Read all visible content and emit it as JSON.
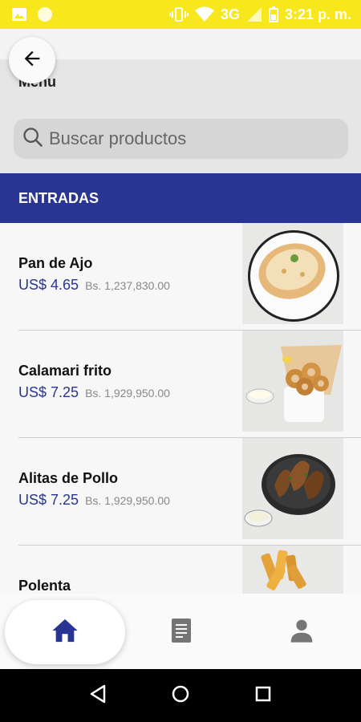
{
  "status_bar": {
    "network": "3G",
    "time": "3:21 p. m.",
    "background": "#f8e71c"
  },
  "header": {
    "title": "Menu"
  },
  "search": {
    "placeholder": "Buscar productos",
    "value": ""
  },
  "section": {
    "title": "ENTRADAS",
    "color": "#283593"
  },
  "products": [
    {
      "name": "Pan de Ajo",
      "price_usd": "US$ 4.65",
      "price_bs": "Bs. 1,237,830.00",
      "image_icon": "garlic-bread-image"
    },
    {
      "name": "Calamari frito",
      "price_usd": "US$ 7.25",
      "price_bs": "Bs. 1,929,950.00",
      "image_icon": "fried-calamari-image"
    },
    {
      "name": "Alitas de Pollo",
      "price_usd": "US$ 7.25",
      "price_bs": "Bs. 1,929,950.00",
      "image_icon": "chicken-wings-image"
    },
    {
      "name": "Polenta",
      "price_usd": "",
      "price_bs": "",
      "image_icon": "polenta-image"
    }
  ],
  "bottom_nav": {
    "items": [
      {
        "icon": "home-icon",
        "active": true
      },
      {
        "icon": "orders-icon",
        "active": false
      },
      {
        "icon": "profile-icon",
        "active": false
      }
    ],
    "active_color": "#283593",
    "inactive_color": "#757575"
  },
  "system_nav": [
    "back-icon",
    "home-circle-icon",
    "recents-icon"
  ]
}
